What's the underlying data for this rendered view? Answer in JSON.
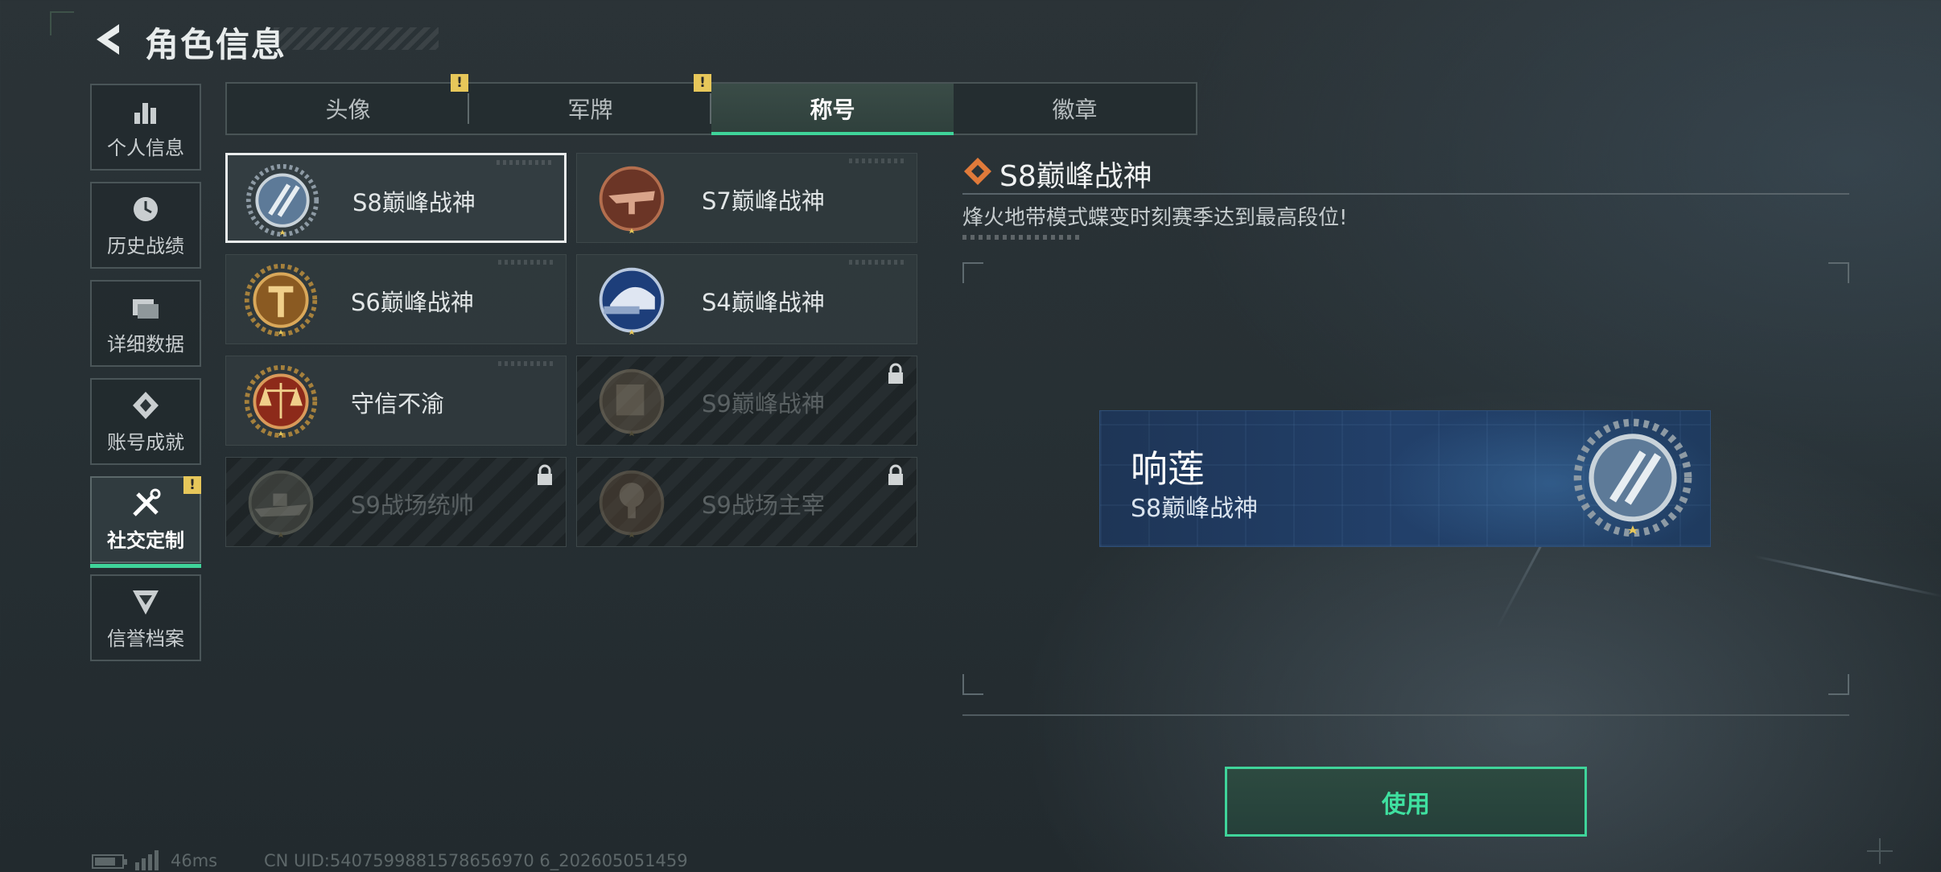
{
  "header": {
    "title": "角色信息",
    "back_icon": "back-arrow-icon"
  },
  "sidebar": {
    "items": [
      {
        "label": "个人信息",
        "icon": "bar-chart-icon",
        "active": false,
        "warning": false
      },
      {
        "label": "历史战绩",
        "icon": "clock-history-icon",
        "active": false,
        "warning": false
      },
      {
        "label": "详细数据",
        "icon": "folder-icon",
        "active": false,
        "warning": false
      },
      {
        "label": "账号成就",
        "icon": "achievement-icon",
        "active": false,
        "warning": false
      },
      {
        "label": "社交定制",
        "icon": "tools-icon",
        "active": true,
        "warning": true
      },
      {
        "label": "信誉档案",
        "icon": "shield-chevron-icon",
        "active": false,
        "warning": false
      }
    ]
  },
  "tabs": [
    {
      "label": "头像",
      "active": false,
      "warning": true
    },
    {
      "label": "军牌",
      "active": false,
      "warning": true
    },
    {
      "label": "称号",
      "active": true,
      "warning": false
    },
    {
      "label": "徽章",
      "active": false,
      "warning": false
    }
  ],
  "warning_glyph": "!",
  "cards": [
    {
      "name": "S8巅峰战神",
      "medal": "s8-medal-icon",
      "selected": true,
      "locked": false
    },
    {
      "name": "S7巅峰战神",
      "medal": "s7-medal-icon",
      "selected": false,
      "locked": false
    },
    {
      "name": "S6巅峰战神",
      "medal": "s6-medal-icon",
      "selected": false,
      "locked": false
    },
    {
      "name": "S4巅峰战神",
      "medal": "s4-medal-icon",
      "selected": false,
      "locked": false
    },
    {
      "name": "守信不渝",
      "medal": "scales-medal-icon",
      "selected": false,
      "locked": false
    },
    {
      "name": "S9巅峰战神",
      "medal": "s9-medal-icon",
      "selected": false,
      "locked": true
    },
    {
      "name": "S9战场统帅",
      "medal": "warship-medal-icon",
      "selected": false,
      "locked": true
    },
    {
      "name": "S9战场主宰",
      "medal": "explosion-medal-icon",
      "selected": false,
      "locked": true
    }
  ],
  "detail": {
    "title": "S8巅峰战神",
    "description": "烽火地带模式蝶变时刻赛季达到最高段位!"
  },
  "preview": {
    "player_name": "响莲",
    "title": "S8巅峰战神"
  },
  "use_button": {
    "label": "使用"
  },
  "status": {
    "ping": "46ms",
    "uid": "CN UID:5407599881578656970 6_202605051459"
  },
  "colors": {
    "accent": "#3fd49a",
    "warning": "#e7c75a",
    "medal_gold": "#c9a24a",
    "preview_bg": "#22406a"
  }
}
